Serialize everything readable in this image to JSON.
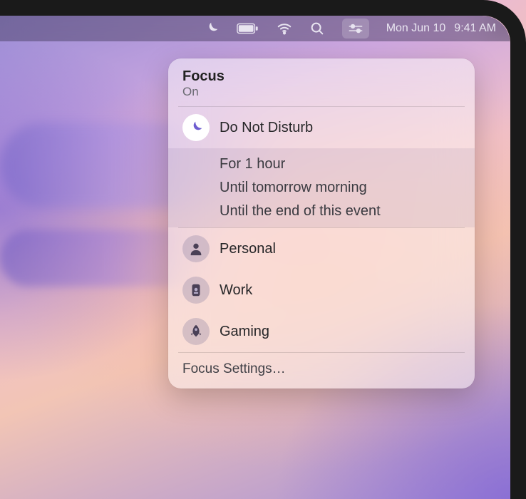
{
  "menubar": {
    "date": "Mon Jun 10",
    "time": "9:41 AM",
    "icons": {
      "focus": "focus-icon",
      "battery": "battery-icon",
      "wifi": "wifi-icon",
      "search": "spotlight-icon",
      "controlCenter": "control-center-icon"
    }
  },
  "focusPanel": {
    "title": "Focus",
    "status": "On",
    "modes": [
      {
        "id": "dnd",
        "label": "Do Not Disturb",
        "icon": "moon-icon",
        "active": true
      },
      {
        "id": "personal",
        "label": "Personal",
        "icon": "person-icon",
        "active": false
      },
      {
        "id": "work",
        "label": "Work",
        "icon": "badge-icon",
        "active": false
      },
      {
        "id": "gaming",
        "label": "Gaming",
        "icon": "rocket-icon",
        "active": false
      }
    ],
    "durationOptions": [
      "For 1 hour",
      "Until tomorrow morning",
      "Until the end of this event"
    ],
    "settingsLabel": "Focus Settings…"
  },
  "colors": {
    "accent": "#6e5dd0",
    "iconInactive": "#4a4056"
  }
}
